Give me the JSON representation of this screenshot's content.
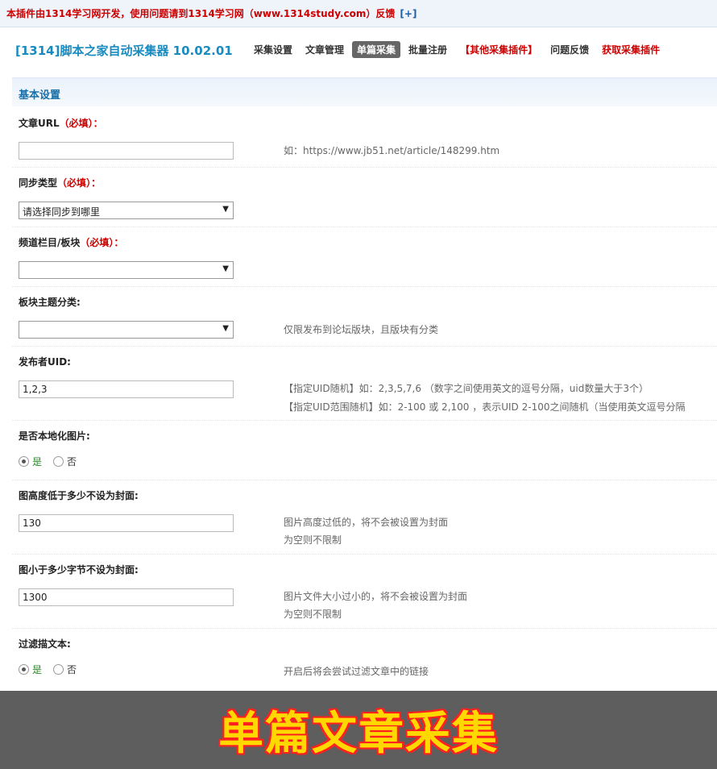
{
  "notice": {
    "text": "本插件由1314学习网开发，使用问题请到1314学习网（www.1314study.com）反馈",
    "link": "[+]"
  },
  "header": {
    "plugin_title": "[1314]脚本之家自动采集器 10.02.01",
    "tabs": [
      {
        "label": "采集设置"
      },
      {
        "label": "文章管理"
      },
      {
        "label": "单篇采集",
        "active": true
      },
      {
        "label": "批量注册"
      },
      {
        "label": "【其他采集插件】"
      },
      {
        "label": "问题反馈"
      },
      {
        "label": "获取采集插件"
      }
    ]
  },
  "section_title": "基本设置",
  "form": {
    "article_url": {
      "label": "文章URL",
      "required": "（必填）：",
      "value": "",
      "hint": "如：https://www.jb51.net/article/148299.htm"
    },
    "sync_type": {
      "label": "同步类型",
      "required": "（必填）：",
      "selected": "请选择同步到哪里"
    },
    "channel": {
      "label": "频道栏目/板块",
      "required": "（必填）：",
      "selected": ""
    },
    "thread_type": {
      "label": "板块主题分类:",
      "selected": "",
      "hint": "仅限发布到论坛版块，且版块有分类"
    },
    "uid": {
      "label": "发布者UID:",
      "value": "1,2,3",
      "hint1": "【指定UID随机】如：2,3,5,7,6 （数字之间使用英文的逗号分隔，uid数量大于3个）",
      "hint2": "【指定UID范围随机】如：2-100 或 2,100 ，表示UID 2-100之间随机（当使用英文逗号分隔"
    },
    "local_images": {
      "label": "是否本地化图片:",
      "yes": "是",
      "no": "否"
    },
    "min_height": {
      "label": "图高度低于多少不设为封面:",
      "value": "130",
      "hint1": "图片高度过低的，将不会被设置为封面",
      "hint2": "为空则不限制"
    },
    "min_size": {
      "label": "图小于多少字节不设为封面:",
      "value": "1300",
      "hint1": "图片文件大小过小的，将不会被设置为封面",
      "hint2": "为空则不限制"
    },
    "filter_links": {
      "label": "过滤描文本:",
      "yes": "是",
      "no": "否",
      "hint": "开启后将会尝试过滤文章中的链接"
    }
  },
  "banner_text": "单篇文章采集",
  "colors": {
    "accent_blue": "#1a8bbf",
    "required_red": "#cc0000",
    "banner_yellow": "#ffd800",
    "banner_bg": "#5e5e5e"
  }
}
